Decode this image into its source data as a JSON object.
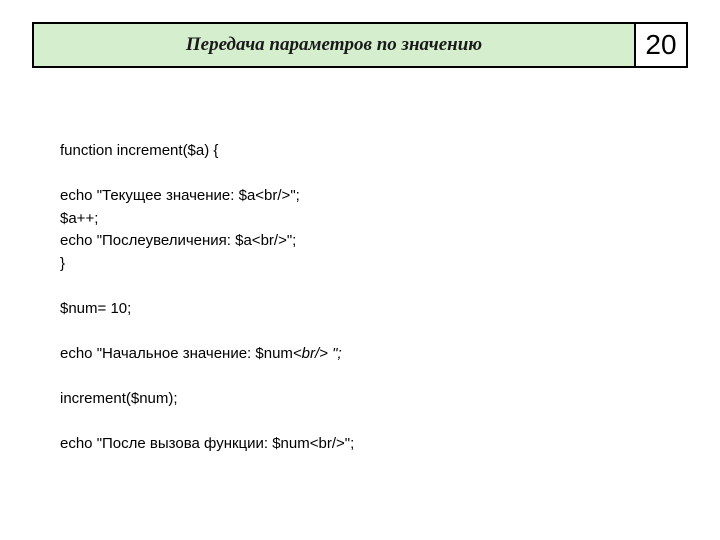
{
  "header": {
    "title": "Передача параметров по значению",
    "page_number": "20"
  },
  "code": {
    "l1": "function increment($a) {",
    "l2": "echo \"Текущее значение: $a<br/>\";",
    "l3": "$a++;",
    "l4": "echo \"Послеувеличения: $a<br/>\";",
    "l5": "}",
    "l6": "$num= 10;",
    "l7a": "echo \"Начальное значение: $num",
    "l7b": "<br/> ",
    "l7c": "\";",
    "l8": "increment($num);",
    "l9": "echo \"После вызова функции: $num<br/>\";"
  }
}
